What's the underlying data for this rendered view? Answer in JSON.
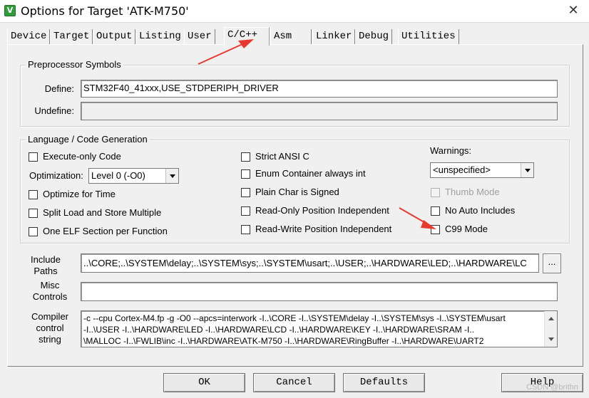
{
  "window": {
    "title": "Options for Target 'ATK-M750'",
    "icon_glyph": "V",
    "close_glyph": "✕"
  },
  "tabs": [
    {
      "label": "Device",
      "active": false
    },
    {
      "label": "Target",
      "active": false
    },
    {
      "label": "Output",
      "active": false
    },
    {
      "label": "Listing",
      "active": false
    },
    {
      "label": "User",
      "active": false
    },
    {
      "label": "C/C++",
      "active": true
    },
    {
      "label": "Asm",
      "active": false
    },
    {
      "label": "Linker",
      "active": false
    },
    {
      "label": "Debug",
      "active": false
    },
    {
      "label": "Utilities",
      "active": false
    }
  ],
  "preprocessor": {
    "group_title": "Preprocessor Symbols",
    "define_label": "Define:",
    "define_value": "STM32F40_41xxx,USE_STDPERIPH_DRIVER",
    "undefine_label": "Undefine:",
    "undefine_value": ""
  },
  "language": {
    "group_title": "Language / Code Generation",
    "execute_only": {
      "label": "Execute-only Code",
      "checked": false
    },
    "optimization_label": "Optimization:",
    "optimization_value": "Level 0 (-O0)",
    "optimize_time": {
      "label": "Optimize for Time",
      "checked": false
    },
    "split_load": {
      "label": "Split Load and Store Multiple",
      "checked": false
    },
    "one_elf": {
      "label": "One ELF Section per Function",
      "checked": false
    },
    "strict_ansi": {
      "label": "Strict ANSI C",
      "checked": false
    },
    "enum_int": {
      "label": "Enum Container always int",
      "checked": false
    },
    "plain_char": {
      "label": "Plain Char is Signed",
      "checked": false
    },
    "ropi": {
      "label": "Read-Only Position Independent",
      "checked": false
    },
    "rwpi": {
      "label": "Read-Write Position Independent",
      "checked": false
    },
    "warnings_label": "Warnings:",
    "warnings_value": "<unspecified>",
    "thumb_mode": {
      "label": "Thumb Mode",
      "checked": false,
      "disabled": true
    },
    "no_auto_includes": {
      "label": "No Auto Includes",
      "checked": false
    },
    "c99_mode": {
      "label": "C99 Mode",
      "checked": false
    }
  },
  "include_paths": {
    "label_line1": "Include",
    "label_line2": "Paths",
    "value": "..\\CORE;..\\SYSTEM\\delay;..\\SYSTEM\\sys;..\\SYSTEM\\usart;..\\USER;..\\HARDWARE\\LED;..\\HARDWARE\\LC",
    "browse_label": "..."
  },
  "misc_controls": {
    "label_line1": "Misc",
    "label_line2": "Controls",
    "value": ""
  },
  "compiler_control": {
    "label_line1": "Compiler",
    "label_line2": "control",
    "label_line3": "string",
    "lines": [
      "-c --cpu Cortex-M4.fp -g -O0 --apcs=interwork -I..\\CORE -I..\\SYSTEM\\delay -I..\\SYSTEM\\sys -I..\\SYSTEM\\usart",
      "-I..\\USER -I..\\HARDWARE\\LED -I..\\HARDWARE\\LCD -I..\\HARDWARE\\KEY -I..\\HARDWARE\\SRAM -I..",
      "\\MALLOC -I..\\FWLIB\\inc -I..\\HARDWARE\\ATK-M750 -I..\\HARDWARE\\RingBuffer -I..\\HARDWARE\\UART2"
    ]
  },
  "buttons": {
    "ok": "OK",
    "cancel": "Cancel",
    "defaults": "Defaults",
    "help": "Help"
  },
  "watermark": "CSDN @brithn",
  "annotation_color": "#e8392f"
}
